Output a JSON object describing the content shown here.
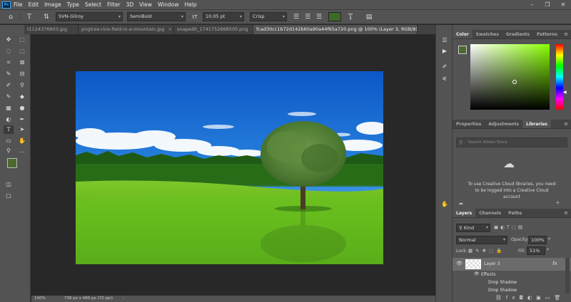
{
  "app": {
    "logo_text": "Ps"
  },
  "menu": [
    "File",
    "Edit",
    "Image",
    "Type",
    "Select",
    "Filter",
    "3D",
    "View",
    "Window",
    "Help"
  ],
  "window_controls": [
    "–",
    "❐",
    "✕"
  ],
  "options_bar": {
    "font_family": "SVN-Gilroy",
    "font_style": "SemiBold",
    "font_size": "10.05 pt",
    "antialias": "Crisp",
    "text_color": "#3f6a2a"
  },
  "tabs": [
    {
      "label": "t1124376603.jpg",
      "active": false
    },
    {
      "label": "pngtree-rice-field-in-a-mountain.jpg",
      "active": false
    },
    {
      "label": "snapedit_1741752668500.png",
      "active": false
    },
    {
      "label": "fcad30cc1b72d142b60a90a44f65a720.png @ 100% (Layer 3, RGB/8) *",
      "active": true
    }
  ],
  "tab_close": "×",
  "status": {
    "zoom": "100%",
    "doc_info": "736 px x 460 px (72 ppi)",
    "arrow": "›"
  },
  "color_panel": {
    "tabs": [
      "Color",
      "Swatches",
      "Gradients",
      "Patterns"
    ],
    "active_tab": "Color",
    "hue_color": "#88ff00",
    "foreground": "#4b6930"
  },
  "libraries_panel": {
    "tabs": [
      "Properties",
      "Adjustments",
      "Libraries"
    ],
    "active_tab": "Libraries",
    "search_placeholder": "Search Adobe Stock",
    "message": "To use Creative Cloud libraries, you need to be logged into a Creative Cloud account"
  },
  "layers_panel": {
    "tabs": [
      "Layers",
      "Channels",
      "Paths"
    ],
    "active_tab": "Layers",
    "filter_kind": "Kind",
    "blend_mode": "Normal",
    "opacity_label": "Opacity:",
    "opacity": "100%",
    "lock_label": "Lock:",
    "fill_label": "Fill:",
    "fill": "51%",
    "layers": [
      {
        "name": "Layer 3",
        "fx": "fx",
        "selected": true
      },
      {
        "name": "Effects",
        "sub": true
      },
      {
        "name": "Drop Shadow",
        "sub": true
      },
      {
        "name": "Drop Shadow",
        "sub": true
      }
    ]
  },
  "menu_icon": "≡"
}
